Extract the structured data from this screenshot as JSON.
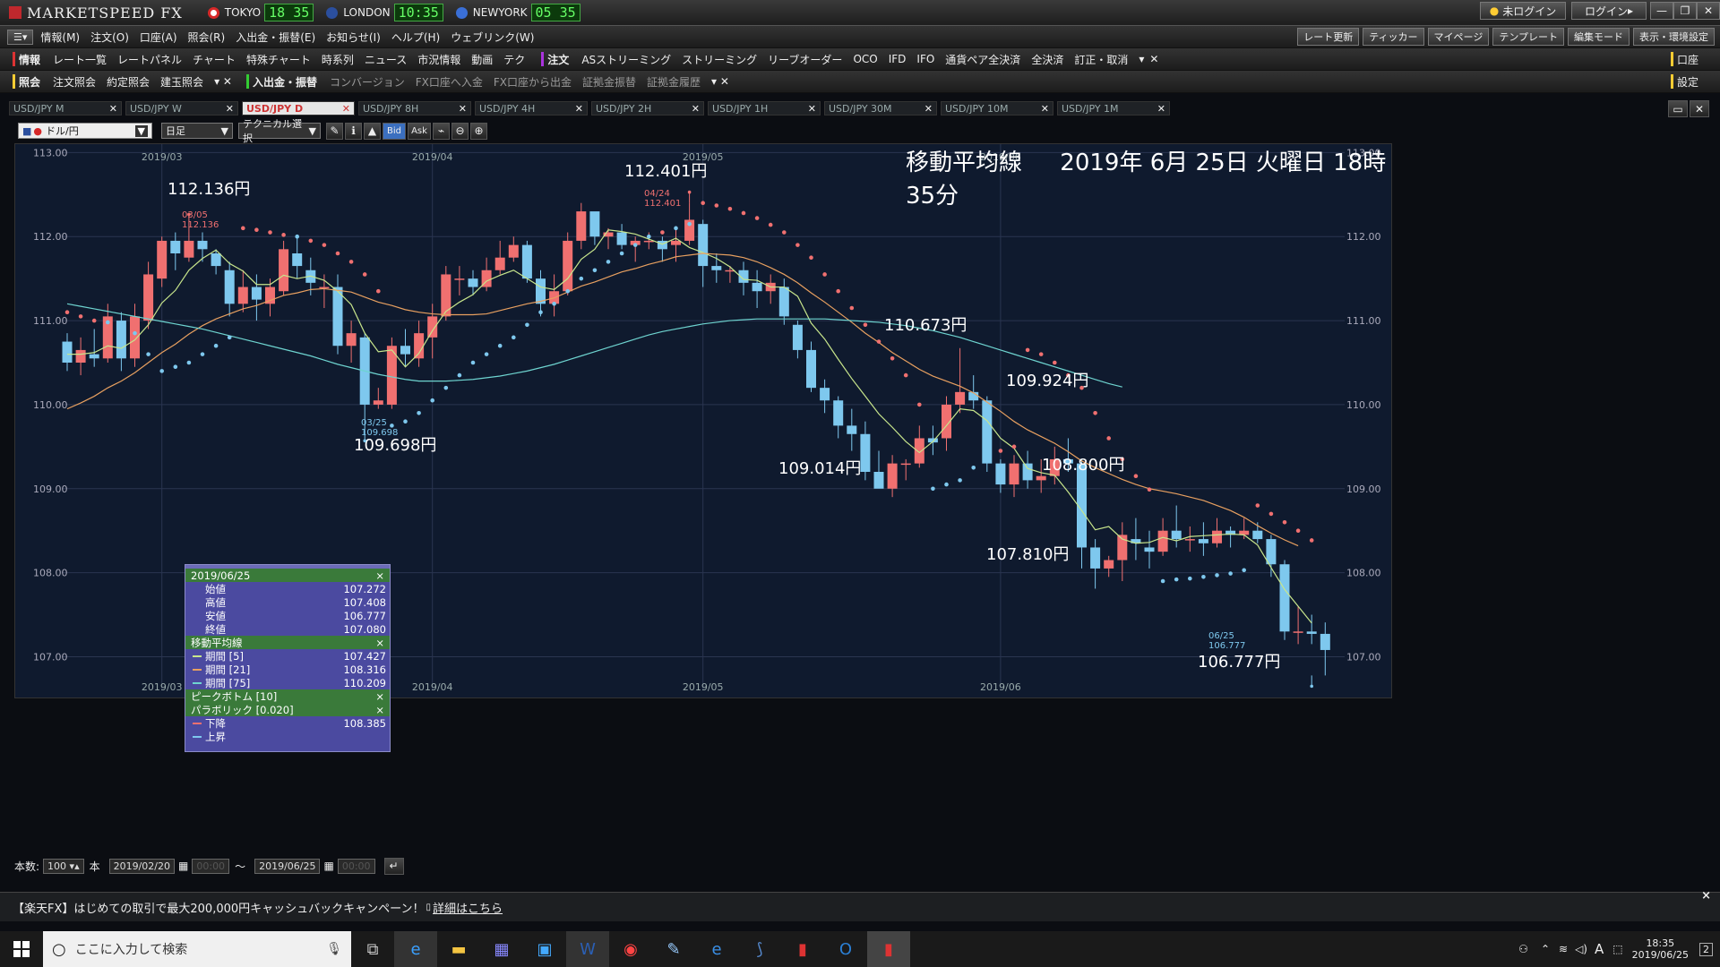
{
  "window": {
    "app_title": "MARKETSPEED FX",
    "clocks": [
      {
        "city": "TOKYO",
        "time": "18 35",
        "flag_color": "#d62828"
      },
      {
        "city": "LONDON",
        "time": "10:35",
        "flag_color": "#2b4f9e"
      },
      {
        "city": "NEWYORK",
        "time": "05 35",
        "flag_color": "#3a6fd6"
      }
    ],
    "login_status": "未ログイン",
    "login_button": "ログイン"
  },
  "menu": {
    "items": [
      "情報(M)",
      "注文(O)",
      "口座(A)",
      "照会(R)",
      "入出金・振替(E)",
      "お知らせ(I)",
      "ヘルプ(H)",
      "ウェブリンク(W)"
    ],
    "right_items": [
      "レート更新",
      "ティッカー",
      "マイページ",
      "テンプレート",
      "編集モード",
      "表示・環境設定"
    ]
  },
  "toolbar_info": {
    "group_label": "情報",
    "items": [
      "レート一覧",
      "レートパネル",
      "チャート",
      "特殊チャート",
      "時系列",
      "ニュース",
      "市況情報",
      "動画",
      "テク"
    ],
    "order_label": "注文",
    "order_items": [
      "ASストリーミング",
      "ストリーミング",
      "リーブオーダー",
      "OCO",
      "IFD",
      "IFO",
      "通貨ペア全決済",
      "全決済",
      "訂正・取消"
    ],
    "right_label": "口座"
  },
  "toolbar_inquiry": {
    "group_label": "照会",
    "items": [
      "注文照会",
      "約定照会",
      "建玉照会"
    ],
    "transfer_label": "入出金・振替",
    "transfer_items": [
      "コンバージョン",
      "FX口座へ入金",
      "FX口座から出金",
      "証拠金振替",
      "証拠金履歴"
    ],
    "right_label": "設定"
  },
  "chart_tabs": [
    {
      "label": "USD/JPY M",
      "active": false
    },
    {
      "label": "USD/JPY W",
      "active": false
    },
    {
      "label": "USD/JPY D",
      "active": true
    },
    {
      "label": "USD/JPY 8H",
      "active": false
    },
    {
      "label": "USD/JPY 4H",
      "active": false
    },
    {
      "label": "USD/JPY 2H",
      "active": false
    },
    {
      "label": "USD/JPY 1H",
      "active": false
    },
    {
      "label": "USD/JPY 30M",
      "active": false
    },
    {
      "label": "USD/JPY 10M",
      "active": false
    },
    {
      "label": "USD/JPY 1M",
      "active": false
    }
  ],
  "chart_toolbar": {
    "pair_select": "ドル/円",
    "period_select": "日足",
    "technical_select": "テクニカル選択",
    "bid": "Bid",
    "ask": "Ask"
  },
  "chart_overlay": {
    "title": "移動平均線",
    "datetime": "2019年 6月 25日 火曜日 18時 35分"
  },
  "annotations": [
    {
      "text": "112.136円",
      "date_label": "03/05",
      "value_label": "112.136"
    },
    {
      "text": "109.698円",
      "date_label": "03/25",
      "value_label": "109.698"
    },
    {
      "text": "112.401円",
      "date_label": "04/24",
      "value_label": "112.401"
    },
    {
      "text": "109.014円"
    },
    {
      "text": "110.673円"
    },
    {
      "text": "109.924円"
    },
    {
      "text": "108.800円"
    },
    {
      "text": "107.810円"
    },
    {
      "text": "106.777円",
      "date_label": "06/25",
      "value_label": "106.777"
    }
  ],
  "info_panel": {
    "date": "2019/06/25",
    "ohlc": [
      {
        "label": "始値",
        "value": "107.272"
      },
      {
        "label": "高値",
        "value": "107.408"
      },
      {
        "label": "安値",
        "value": "106.777"
      },
      {
        "label": "終値",
        "value": "107.080"
      }
    ],
    "ma_header": "移動平均線",
    "ma": [
      {
        "label": "期間 [5]",
        "value": "107.427",
        "color": "#c8e68c"
      },
      {
        "label": "期間 [21]",
        "value": "108.316",
        "color": "#e8a060"
      },
      {
        "label": "期間 [75]",
        "value": "110.209",
        "color": "#6ed4d0"
      }
    ],
    "peak_header": "ピークボトム [10]",
    "sar_header": "パラボリック [0.020]",
    "sar": [
      {
        "label": "下降",
        "value": "108.385"
      },
      {
        "label": "上昇",
        "value": ""
      }
    ]
  },
  "range_bar": {
    "count_label": "本数:",
    "count_value": "100",
    "count_unit": "本",
    "from_date": "2019/02/20",
    "from_time": "00:00",
    "to_date": "2019/06/25",
    "to_time": "00:00",
    "sep": "～"
  },
  "banner": {
    "text": "【楽天FX】はじめての取引で最大200,000円キャッシュバックキャンペーン！",
    "link": "詳細はこちら"
  },
  "taskbar": {
    "search_placeholder": "ここに入力して検索",
    "time": "18:35",
    "date": "2019/06/25",
    "ime": "A",
    "notif_count": "2"
  },
  "colors": {
    "up": "#f07070",
    "down": "#7ec8ee",
    "ma5": "#c8e68c",
    "ma21": "#e8a060",
    "ma75": "#6ed4d0",
    "sar_down": "#f07070",
    "sar_up": "#7ec8ee"
  },
  "chart_data": {
    "type": "candlestick",
    "pair": "USD/JPY",
    "timeframe": "日足",
    "ylim": [
      106.6,
      113.1
    ],
    "y_ticks": [
      "113.00",
      "112.00",
      "111.00",
      "110.00",
      "109.00",
      "108.00",
      "107.00"
    ],
    "x_ticks": [
      {
        "label": "2019/03",
        "index": 7
      },
      {
        "label": "2019/04",
        "index": 27
      },
      {
        "label": "2019/05",
        "index": 47
      },
      {
        "label": "2019/06",
        "index": 69
      }
    ],
    "candles": [
      [
        110.75,
        110.5,
        110.85,
        110.4
      ],
      [
        110.5,
        110.65,
        110.8,
        110.35
      ],
      [
        110.6,
        110.55,
        110.9,
        110.45
      ],
      [
        110.55,
        111.05,
        111.2,
        110.5
      ],
      [
        111.0,
        110.55,
        111.1,
        110.4
      ],
      [
        110.55,
        111.05,
        111.2,
        110.45
      ],
      [
        111.0,
        111.55,
        111.7,
        110.9
      ],
      [
        111.5,
        111.95,
        112.0,
        111.4
      ],
      [
        111.95,
        111.8,
        112.05,
        111.6
      ],
      [
        111.75,
        111.95,
        112.136,
        111.7
      ],
      [
        111.95,
        111.85,
        112.05,
        111.7
      ],
      [
        111.8,
        111.65,
        111.85,
        111.55
      ],
      [
        111.6,
        111.2,
        111.7,
        111.05
      ],
      [
        111.2,
        111.4,
        111.6,
        111.1
      ],
      [
        111.4,
        111.25,
        111.55,
        111.0
      ],
      [
        111.2,
        111.4,
        111.5,
        111.05
      ],
      [
        111.35,
        111.85,
        111.95,
        111.3
      ],
      [
        111.8,
        111.65,
        112.0,
        111.5
      ],
      [
        111.6,
        111.45,
        111.75,
        111.3
      ],
      [
        111.4,
        111.4,
        111.55,
        111.15
      ],
      [
        111.4,
        110.7,
        111.55,
        110.6
      ],
      [
        110.7,
        110.85,
        111.0,
        110.5
      ],
      [
        110.8,
        110.0,
        110.85,
        109.698
      ],
      [
        110.0,
        110.05,
        110.2,
        109.95
      ],
      [
        110.0,
        110.7,
        110.8,
        109.95
      ],
      [
        110.7,
        110.6,
        110.9,
        110.45
      ],
      [
        110.55,
        110.85,
        111.0,
        110.45
      ],
      [
        110.8,
        111.05,
        111.2,
        110.55
      ],
      [
        111.05,
        111.55,
        111.65,
        111.0
      ],
      [
        111.5,
        111.5,
        111.65,
        111.3
      ],
      [
        111.5,
        111.4,
        111.6,
        111.3
      ],
      [
        111.4,
        111.6,
        111.75,
        111.35
      ],
      [
        111.6,
        111.75,
        111.95,
        111.55
      ],
      [
        111.75,
        111.9,
        112.0,
        111.7
      ],
      [
        111.9,
        111.5,
        111.95,
        111.45
      ],
      [
        111.5,
        111.2,
        111.6,
        111.05
      ],
      [
        111.2,
        111.35,
        111.55,
        111.05
      ],
      [
        111.35,
        111.95,
        112.05,
        111.3
      ],
      [
        111.95,
        112.3,
        112.4,
        111.85
      ],
      [
        112.3,
        112.0,
        112.05,
        111.9
      ],
      [
        112.0,
        112.05,
        112.1,
        111.85
      ],
      [
        112.05,
        111.9,
        112.15,
        111.85
      ],
      [
        111.9,
        111.95,
        112.0,
        111.7
      ],
      [
        111.95,
        111.95,
        112.05,
        111.85
      ],
      [
        111.95,
        111.85,
        112.0,
        111.7
      ],
      [
        111.9,
        111.95,
        112.1,
        111.7
      ],
      [
        111.95,
        112.2,
        112.401,
        111.9
      ],
      [
        112.15,
        111.65,
        112.2,
        111.4
      ],
      [
        111.65,
        111.6,
        111.8,
        111.45
      ],
      [
        111.6,
        111.6,
        111.65,
        111.45
      ],
      [
        111.6,
        111.45,
        111.7,
        111.3
      ],
      [
        111.45,
        111.35,
        111.6,
        111.15
      ],
      [
        111.35,
        111.45,
        111.55,
        111.2
      ],
      [
        111.4,
        111.05,
        111.5,
        110.95
      ],
      [
        110.95,
        110.65,
        111.0,
        110.55
      ],
      [
        110.65,
        110.2,
        110.75,
        110.15
      ],
      [
        110.2,
        110.05,
        110.3,
        109.9
      ],
      [
        110.05,
        109.75,
        110.1,
        109.6
      ],
      [
        109.75,
        109.65,
        109.95,
        109.45
      ],
      [
        109.65,
        109.2,
        109.8,
        109.1
      ],
      [
        109.2,
        109.0,
        109.45,
        109.014
      ],
      [
        109.0,
        109.3,
        109.4,
        108.9
      ],
      [
        109.3,
        109.3,
        109.35,
        109.1
      ],
      [
        109.3,
        109.6,
        109.75,
        109.25
      ],
      [
        109.6,
        109.55,
        109.75,
        109.4
      ],
      [
        109.6,
        110.0,
        110.1,
        109.45
      ],
      [
        110.0,
        110.15,
        110.673,
        109.9
      ],
      [
        110.15,
        110.05,
        110.35,
        109.95
      ],
      [
        110.05,
        109.3,
        110.1,
        109.2
      ],
      [
        109.3,
        109.05,
        109.35,
        108.95
      ],
      [
        109.05,
        109.3,
        109.4,
        108.9
      ],
      [
        109.3,
        109.1,
        109.45,
        109.0
      ],
      [
        109.1,
        109.15,
        109.35,
        108.95
      ],
      [
        109.15,
        109.35,
        109.5,
        109.05
      ],
      [
        109.35,
        109.3,
        109.6,
        109.2
      ],
      [
        109.3,
        108.3,
        109.35,
        108.05
      ],
      [
        108.3,
        108.05,
        108.4,
        107.81
      ],
      [
        108.05,
        108.15,
        108.2,
        107.95
      ],
      [
        108.15,
        108.45,
        108.6,
        107.9
      ],
      [
        108.4,
        108.35,
        108.65,
        108.15
      ],
      [
        108.3,
        108.25,
        108.5,
        108.05
      ],
      [
        108.25,
        108.5,
        108.65,
        108.2
      ],
      [
        108.5,
        108.4,
        108.8,
        108.3
      ],
      [
        108.4,
        108.4,
        108.55,
        108.25
      ],
      [
        108.4,
        108.35,
        108.6,
        108.2
      ],
      [
        108.35,
        108.5,
        108.65,
        108.3
      ],
      [
        108.5,
        108.45,
        108.55,
        108.3
      ],
      [
        108.45,
        108.5,
        108.65,
        108.4
      ],
      [
        108.5,
        108.4,
        108.6,
        108.35
      ],
      [
        108.4,
        108.1,
        108.45,
        107.95
      ],
      [
        108.1,
        107.3,
        108.15,
        107.2
      ],
      [
        107.3,
        107.3,
        107.6,
        107.15
      ],
      [
        107.3,
        107.272,
        107.5,
        107.15
      ],
      [
        107.272,
        107.08,
        107.408,
        106.777
      ]
    ],
    "series": [
      {
        "name": "期間 [5]",
        "values": [
          110.6,
          110.6,
          110.62,
          110.7,
          110.67,
          110.77,
          110.95,
          111.21,
          111.36,
          111.6,
          111.74,
          111.84,
          111.68,
          111.59,
          111.43,
          111.43,
          111.54,
          111.5,
          111.53,
          111.48,
          111.35,
          111.19,
          110.85,
          110.63,
          110.65,
          110.45,
          110.61,
          110.88,
          111.11,
          111.22,
          111.31,
          111.47,
          111.54,
          111.6,
          111.5,
          111.4,
          111.37,
          111.5,
          111.73,
          111.85,
          112.08,
          112.06,
          112.03,
          111.97,
          111.91,
          111.98,
          111.87,
          111.81,
          111.74,
          111.64,
          111.49,
          111.48,
          111.4,
          111.4,
          111.29,
          110.97,
          110.78,
          110.54,
          110.31,
          110.1,
          109.89,
          109.73,
          109.56,
          109.43,
          109.56,
          109.75,
          109.95,
          109.93,
          109.81,
          109.6,
          109.48,
          109.24,
          109.19,
          109.16,
          108.96,
          108.74,
          108.51,
          108.55,
          108.4,
          108.35,
          108.36,
          108.42,
          108.38,
          108.43,
          108.44,
          108.45,
          108.46,
          108.45,
          108.33,
          108.06,
          107.8,
          107.6,
          107.4
        ],
        "color": "#c8e68c"
      },
      {
        "name": "期間 [21]",
        "values": [
          109.95,
          110.02,
          110.1,
          110.2,
          110.28,
          110.38,
          110.5,
          110.62,
          110.72,
          110.84,
          110.94,
          111.02,
          111.08,
          111.14,
          111.18,
          111.24,
          111.3,
          111.33,
          111.37,
          111.38,
          111.36,
          111.34,
          111.28,
          111.22,
          111.18,
          111.13,
          111.1,
          111.08,
          111.07,
          111.07,
          111.07,
          111.08,
          111.12,
          111.16,
          111.2,
          111.23,
          111.27,
          111.34,
          111.41,
          111.46,
          111.52,
          111.58,
          111.62,
          111.67,
          111.71,
          111.76,
          111.78,
          111.8,
          111.79,
          111.78,
          111.75,
          111.7,
          111.63,
          111.55,
          111.45,
          111.33,
          111.22,
          111.1,
          110.98,
          110.85,
          110.74,
          110.62,
          110.52,
          110.42,
          110.34,
          110.28,
          110.22,
          110.14,
          110.03,
          109.92,
          109.8,
          109.7,
          109.62,
          109.54,
          109.44,
          109.33,
          109.25,
          109.18,
          109.11,
          109.05,
          109.0,
          108.97,
          108.94,
          108.9,
          108.86,
          108.8,
          108.74,
          108.66,
          108.56,
          108.47,
          108.39,
          108.32
        ],
        "color": "#e8a060"
      },
      {
        "name": "期間 [75]",
        "values": [
          111.2,
          111.17,
          111.14,
          111.11,
          111.08,
          111.05,
          111.02,
          110.99,
          110.96,
          110.93,
          110.9,
          110.86,
          110.82,
          110.78,
          110.74,
          110.7,
          110.66,
          110.62,
          110.58,
          110.53,
          110.48,
          110.44,
          110.4,
          110.36,
          110.33,
          110.3,
          110.28,
          110.28,
          110.28,
          110.29,
          110.3,
          110.32,
          110.34,
          110.37,
          110.4,
          110.44,
          110.48,
          110.53,
          110.58,
          110.63,
          110.68,
          110.73,
          110.78,
          110.83,
          110.87,
          110.9,
          110.93,
          110.96,
          110.98,
          111.0,
          111.01,
          111.02,
          111.02,
          111.02,
          111.02,
          111.02,
          111.02,
          111.01,
          111.0,
          110.99,
          110.98,
          110.96,
          110.94,
          110.91,
          110.88,
          110.84,
          110.8,
          110.75,
          110.7,
          110.65,
          110.6,
          110.55,
          110.5,
          110.45,
          110.4,
          110.35,
          110.3,
          110.25,
          110.21
        ],
        "color": "#6ed4d0",
        "start_index": 0
      },
      {
        "name": "パラボリック",
        "values": [
          111.1,
          111.05,
          111.0,
          110.98,
          110.95,
          110.85,
          110.6,
          110.4,
          110.45,
          110.5,
          110.6,
          110.7,
          110.8,
          112.1,
          112.08,
          112.05,
          112.02,
          112.0,
          111.95,
          111.9,
          111.8,
          111.7,
          111.55,
          111.35,
          109.75,
          109.8,
          109.9,
          110.05,
          110.2,
          110.35,
          110.5,
          110.6,
          110.7,
          110.8,
          110.95,
          111.1,
          111.2,
          111.35,
          111.5,
          111.6,
          111.7,
          111.8,
          111.9,
          112.0,
          112.05,
          112.1,
          112.15,
          112.4,
          112.37,
          112.33,
          112.28,
          112.22,
          112.14,
          112.05,
          111.9,
          111.75,
          111.55,
          111.35,
          111.15,
          110.95,
          110.75,
          110.55,
          110.35,
          110.0,
          109.0,
          109.05,
          109.1,
          109.25,
          109.35,
          109.45,
          109.5,
          110.65,
          110.6,
          110.5,
          110.35,
          110.2,
          109.9,
          109.6,
          109.35,
          109.15,
          108.99,
          107.9,
          107.92,
          107.93,
          107.95,
          107.97,
          107.99,
          108.03,
          108.8,
          108.7,
          108.6,
          108.5,
          108.385
        ],
        "color": "#f07070"
      }
    ]
  }
}
